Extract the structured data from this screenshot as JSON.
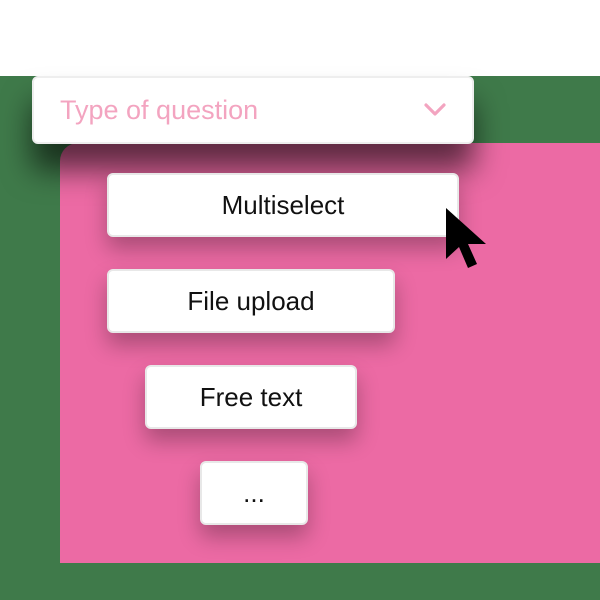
{
  "dropdown": {
    "label": "Type of question",
    "options": [
      "Multiselect",
      "File upload",
      "Free text",
      "..."
    ]
  },
  "colors": {
    "accent_pink": "#ec6aa4",
    "label_pink": "#f3a4c0",
    "background_green": "#3f7a4a"
  }
}
